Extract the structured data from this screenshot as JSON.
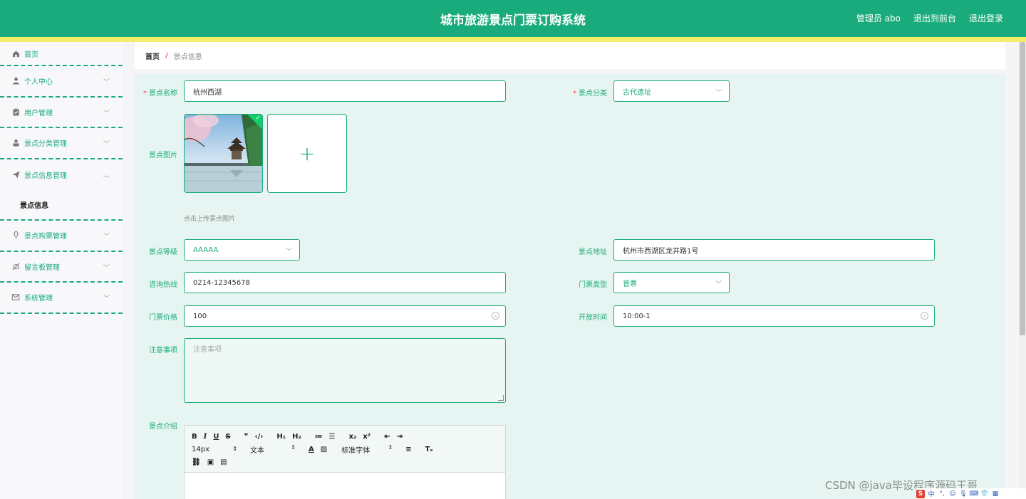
{
  "header": {
    "title": "城市旅游景点门票订购系统",
    "user": "管理员 abo",
    "exit_front": "退出到前台",
    "logout": "退出登录"
  },
  "sidebar": {
    "items": [
      {
        "label": "首页",
        "icon": "home-icon"
      },
      {
        "label": "个人中心",
        "icon": "user-icon"
      },
      {
        "label": "用户管理",
        "icon": "clipboard-icon"
      },
      {
        "label": "景点分类管理",
        "icon": "person-icon"
      },
      {
        "label": "景点信息管理",
        "icon": "send-icon",
        "expanded": true
      },
      {
        "label": "景点购票管理",
        "icon": "microphone-icon"
      },
      {
        "label": "留言板管理",
        "icon": "bell-off-icon"
      },
      {
        "label": "系统管理",
        "icon": "mail-icon"
      }
    ],
    "submenu_active": "景点信息"
  },
  "breadcrumb": {
    "home": "首页",
    "separator": "/",
    "current": "景点信息"
  },
  "form": {
    "name": {
      "label": "景点名称",
      "value": "杭州西湖"
    },
    "category": {
      "label": "景点分类",
      "value": "古代遗址"
    },
    "image": {
      "label": "景点图片",
      "hint": "点击上传景点图片"
    },
    "level": {
      "label": "景点等级",
      "value": "AAAAA"
    },
    "address": {
      "label": "景点地址",
      "value": "杭州市西湖区龙井路1号"
    },
    "hotline": {
      "label": "咨询热线",
      "value": "0214-12345678"
    },
    "ticket_type": {
      "label": "门票类型",
      "value": "普票"
    },
    "price": {
      "label": "门票价格",
      "value": "100"
    },
    "open_time": {
      "label": "开放时间",
      "value": "10:00-1"
    },
    "notes": {
      "label": "注意事项",
      "placeholder": "注意事项"
    },
    "intro": {
      "label": "景点介绍"
    },
    "required_mark": "*"
  },
  "editor": {
    "font_size": "14px",
    "text_type": "文本",
    "font_family": "标准字体"
  },
  "watermark": "CSDN @java毕设程序源码王哥",
  "tray": {
    "ime_label": "中"
  },
  "colors": {
    "primary": "#1aab7d",
    "strip": "#f3ee67",
    "required": "#f05050"
  }
}
